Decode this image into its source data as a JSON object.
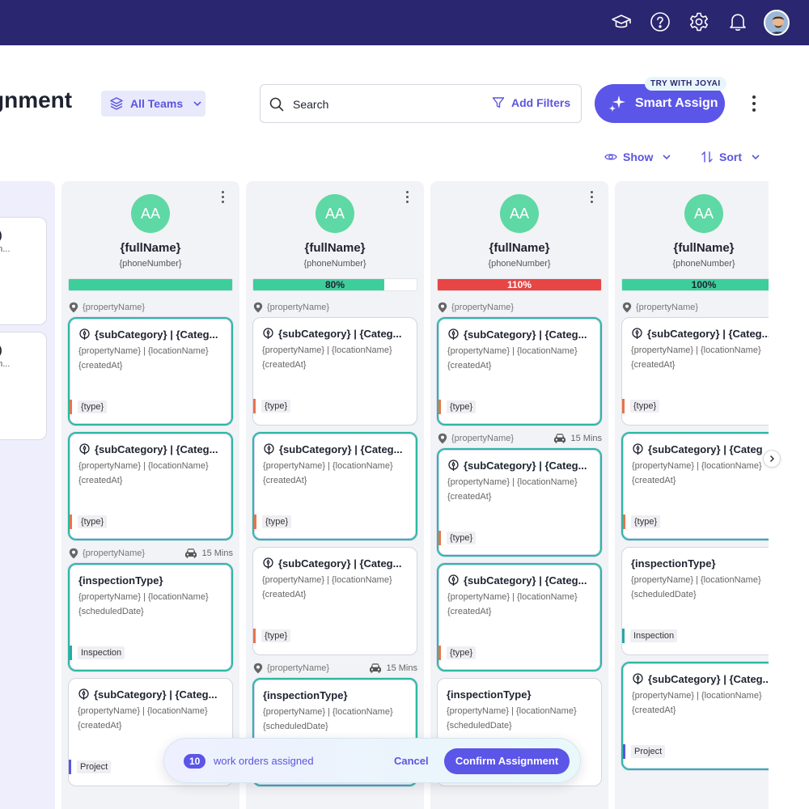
{
  "topbar": {
    "icons": [
      "graduation-cap-icon",
      "help-icon",
      "gear-icon",
      "bell-icon"
    ],
    "avatar": "user-avatar"
  },
  "header": {
    "title": "gnment",
    "team_select": "All Teams",
    "search_placeholder": "Search",
    "add_filters": "Add Filters",
    "smart_assign": "Smart Assign",
    "joyai_badge": "TRY WITH JOYAI",
    "show": "Show",
    "sort": "Sort"
  },
  "partial_column": {
    "cards": [
      {
        "line1": "y)",
        "line2": "on..."
      },
      {
        "line1": "y)",
        "line2": "on..."
      }
    ]
  },
  "columns": [
    {
      "initials": "AA",
      "name": "{fullName}",
      "phone": "{phoneNumber}",
      "capacity_label": "",
      "capacity_percent": 100,
      "capacity_color": "#3dcf9b",
      "groups": [
        {
          "property": "{propertyName}",
          "travel": "",
          "cards": [
            {
              "kind": "sub",
              "title": "{subCategory} | {Categ...",
              "sub1": "{propertyName}  |  {locationName}",
              "sub2": "{createdAt}",
              "tag": "{type}",
              "tag_color": "#e8734a",
              "selected": true
            },
            {
              "kind": "sub",
              "title": "{subCategory} | {Categ...",
              "sub1": "{propertyName}  |  {locationName}",
              "sub2": "{createdAt}",
              "tag": "{type}",
              "tag_color": "#e8734a",
              "selected": true
            }
          ]
        },
        {
          "property": "{propertyName}",
          "travel": "15 Mins",
          "cards": [
            {
              "kind": "insp",
              "title": "{inspectionType}",
              "sub1": "{propertyName}  |  {locationName}",
              "sub2": "{scheduledDate}",
              "tag": "Inspection",
              "tag_color": "#2aa6a8",
              "selected": true
            }
          ]
        },
        {
          "property": "",
          "travel": "",
          "cards": [
            {
              "kind": "sub",
              "title": "{subCategory} | {Categ...",
              "sub1": "{propertyName}  |  {locationName}",
              "sub2": "{createdAt}",
              "tag": "Project",
              "tag_color": "#5b55e0",
              "selected": false
            }
          ]
        }
      ]
    },
    {
      "initials": "AA",
      "name": "{fullName}",
      "phone": "{phoneNumber}",
      "capacity_label": "80%",
      "capacity_percent": 80,
      "capacity_color": "#3dcf9b",
      "groups": [
        {
          "property": "{propertyName}",
          "travel": "",
          "cards": [
            {
              "kind": "sub",
              "title": "{subCategory} | {Categ...",
              "sub1": "{propertyName}  |  {locationName}",
              "sub2": "{createdAt}",
              "tag": "{type}",
              "tag_color": "#e8734a",
              "selected": false
            },
            {
              "kind": "sub",
              "title": "{subCategory} | {Categ...",
              "sub1": "{propertyName}  |  {locationName}",
              "sub2": "{createdAt}",
              "tag": "{type}",
              "tag_color": "#e8734a",
              "selected": true
            },
            {
              "kind": "sub",
              "title": "{subCategory} | {Categ...",
              "sub1": "{propertyName}  |  {locationName}",
              "sub2": "{createdAt}",
              "tag": "{type}",
              "tag_color": "#e8734a",
              "selected": false
            }
          ]
        },
        {
          "property": "{propertyName}",
          "travel": "15 Mins",
          "cards": [
            {
              "kind": "insp",
              "title": "{inspectionType}",
              "sub1": "{propertyName}  |  {locationName}",
              "sub2": "{scheduledDate}",
              "tag": "",
              "tag_color": "#2aa6a8",
              "selected": true
            }
          ]
        }
      ]
    },
    {
      "initials": "AA",
      "name": "{fullName}",
      "phone": "{phoneNumber}",
      "capacity_label": "110%",
      "capacity_percent": 110,
      "capacity_color": "#e84545",
      "groups": [
        {
          "property": "{propertyName}",
          "travel": "",
          "cards": [
            {
              "kind": "sub",
              "title": "{subCategory} | {Categ...",
              "sub1": "{propertyName}  |  {locationName}",
              "sub2": "{createdAt}",
              "tag": "{type}",
              "tag_color": "#e8734a",
              "selected": true
            }
          ]
        },
        {
          "property": "{propertyName}",
          "travel": "15 Mins",
          "cards": [
            {
              "kind": "sub",
              "title": "{subCategory} | {Categ...",
              "sub1": "{propertyName}  |  {locationName}",
              "sub2": "{createdAt}",
              "tag": "{type}",
              "tag_color": "#e8734a",
              "selected": true
            },
            {
              "kind": "sub",
              "title": "{subCategory} | {Categ...",
              "sub1": "{propertyName}  |  {locationName}",
              "sub2": "{createdAt}",
              "tag": "{type}",
              "tag_color": "#e8734a",
              "selected": true
            },
            {
              "kind": "insp",
              "title": "{inspectionType}",
              "sub1": "{propertyName}  |  {locationName}",
              "sub2": "{scheduledDate}",
              "tag": "",
              "tag_color": "#2aa6a8",
              "selected": false
            }
          ]
        }
      ]
    },
    {
      "initials": "AA",
      "name": "{fullName}",
      "phone": "{phoneNumber}",
      "capacity_label": "100%",
      "capacity_percent": 100,
      "capacity_color": "#3dcf9b",
      "groups": [
        {
          "property": "{propertyName}",
          "travel": "",
          "cards": [
            {
              "kind": "sub",
              "title": "{subCategory} | {Categ...",
              "sub1": "{propertyName}  |  {locationName}",
              "sub2": "{createdAt}",
              "tag": "{type}",
              "tag_color": "#e8734a",
              "selected": false
            },
            {
              "kind": "sub",
              "title": "{subCategory} | {Categ",
              "sub1": "{propertyName}  |  {locationName}",
              "sub2": "{createdAt}",
              "tag": "{type}",
              "tag_color": "#e8734a",
              "selected": true
            },
            {
              "kind": "insp",
              "title": "{inspectionType}",
              "sub1": "{propertyName}  |  {locationName}",
              "sub2": "{scheduledDate}",
              "tag": "Inspection",
              "tag_color": "#2aa6a8",
              "selected": false
            },
            {
              "kind": "sub",
              "title": "{subCategory} | {Categ...",
              "sub1": "{propertyName}  |  {locationName}",
              "sub2": "{createdAt}",
              "tag": "Project",
              "tag_color": "#5b55e0",
              "selected": true
            }
          ]
        }
      ]
    }
  ],
  "assign_bar": {
    "count": "10",
    "text": "work orders assigned",
    "cancel": "Cancel",
    "confirm": "Confirm Assignment"
  }
}
